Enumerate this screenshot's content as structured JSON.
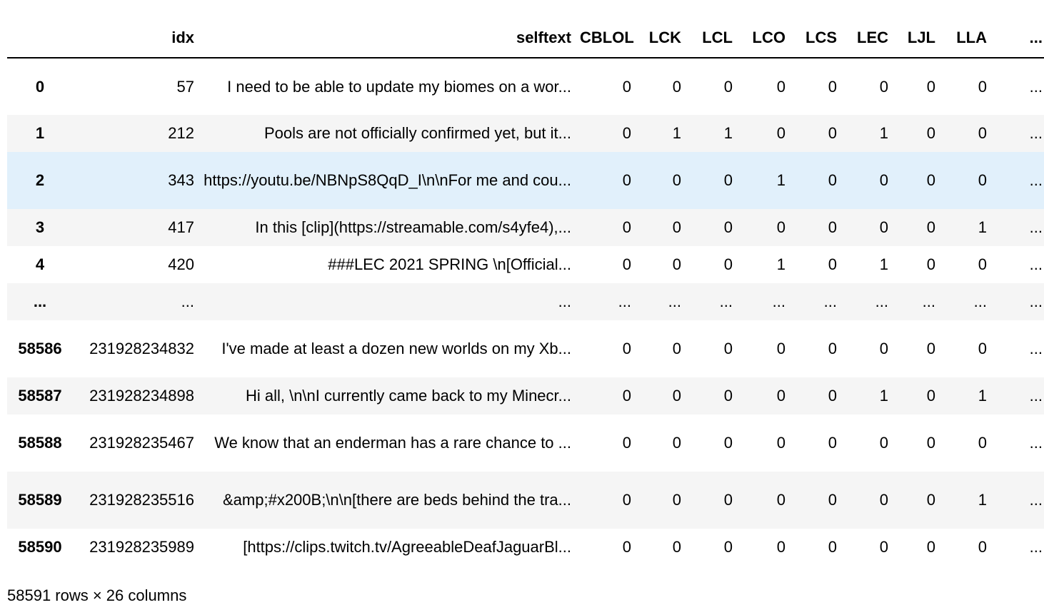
{
  "table": {
    "columns": [
      "",
      "idx",
      "selftext",
      "CBLOL",
      "LCK",
      "LCL",
      "LCO",
      "LCS",
      "LEC",
      "LJL",
      "LLA",
      "..."
    ],
    "rows": [
      {
        "index": "0",
        "idx": "57",
        "selftext": "I need to be able to update my biomes on a wor...",
        "vals": [
          "0",
          "0",
          "0",
          "0",
          "0",
          "0",
          "0",
          "0",
          "..."
        ]
      },
      {
        "index": "1",
        "idx": "212",
        "selftext": "Pools are not officially confirmed yet, but it...",
        "vals": [
          "0",
          "1",
          "1",
          "0",
          "0",
          "1",
          "0",
          "0",
          "..."
        ]
      },
      {
        "index": "2",
        "idx": "343",
        "selftext": "https://youtu.be/NBNpS8QqD_I\\n\\nFor me and cou...",
        "vals": [
          "0",
          "0",
          "0",
          "1",
          "0",
          "0",
          "0",
          "0",
          "..."
        ]
      },
      {
        "index": "3",
        "idx": "417",
        "selftext": "In this [clip](https://streamable.com/s4yfe4),...",
        "vals": [
          "0",
          "0",
          "0",
          "0",
          "0",
          "0",
          "0",
          "1",
          "..."
        ]
      },
      {
        "index": "4",
        "idx": "420",
        "selftext": "###LEC 2021 SPRING \\n[Official...",
        "vals": [
          "0",
          "0",
          "0",
          "1",
          "0",
          "1",
          "0",
          "0",
          "..."
        ]
      },
      {
        "index": "...",
        "idx": "...",
        "selftext": "...",
        "vals": [
          "...",
          "...",
          "...",
          "...",
          "...",
          "...",
          "...",
          "...",
          "..."
        ]
      },
      {
        "index": "58586",
        "idx": "231928234832",
        "selftext": "I've made at least a dozen new worlds on my Xb...",
        "vals": [
          "0",
          "0",
          "0",
          "0",
          "0",
          "0",
          "0",
          "0",
          "..."
        ]
      },
      {
        "index": "58587",
        "idx": "231928234898",
        "selftext": "Hi all, \\n\\nI currently came back to my Minecr...",
        "vals": [
          "0",
          "0",
          "0",
          "0",
          "0",
          "1",
          "0",
          "1",
          "..."
        ]
      },
      {
        "index": "58588",
        "idx": "231928235467",
        "selftext": "We know that an enderman has a rare chance to ...",
        "vals": [
          "0",
          "0",
          "0",
          "0",
          "0",
          "0",
          "0",
          "0",
          "..."
        ]
      },
      {
        "index": "58589",
        "idx": "231928235516",
        "selftext": "&amp;#x200B;\\n\\n[there are beds behind the tra...",
        "vals": [
          "0",
          "0",
          "0",
          "0",
          "0",
          "0",
          "0",
          "1",
          "..."
        ]
      },
      {
        "index": "58590",
        "idx": "231928235989",
        "selftext": "[https://clips.twitch.tv/AgreeableDeafJaguarBl...",
        "vals": [
          "0",
          "0",
          "0",
          "0",
          "0",
          "0",
          "0",
          "0",
          "..."
        ]
      }
    ]
  },
  "footer": "58591 rows × 26 columns"
}
